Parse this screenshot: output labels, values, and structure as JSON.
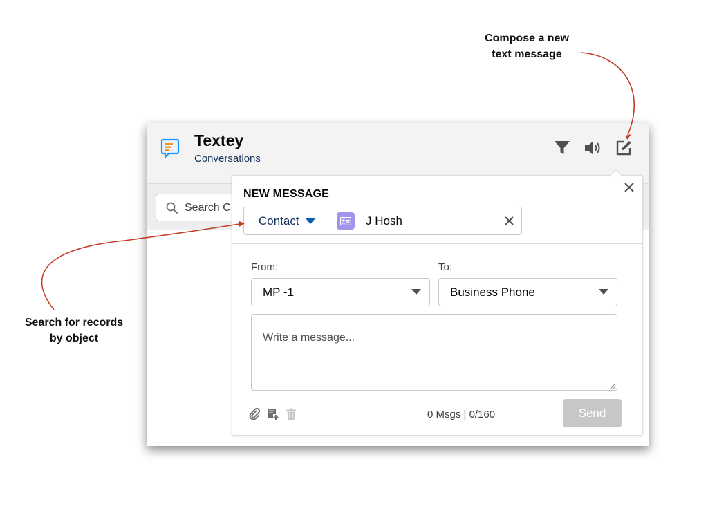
{
  "callouts": {
    "compose_line1": "Compose a new",
    "compose_line2": "text message",
    "search_line1": "Search for records",
    "search_line2": "by object"
  },
  "app": {
    "title": "Textey",
    "subtitle": "Conversations",
    "icon": "chat-bubble-icon",
    "header_actions": [
      {
        "icon": "filter-icon"
      },
      {
        "icon": "speaker-icon"
      },
      {
        "icon": "compose-icon"
      }
    ]
  },
  "search": {
    "placeholder": "Search C",
    "icon": "search-icon"
  },
  "new_message": {
    "title": "NEW MESSAGE",
    "close_icon": "close-icon",
    "lookup": {
      "object_label": "Contact",
      "record_name": "J Hosh",
      "record_icon": "contact-card-icon",
      "clear_icon": "close-icon"
    },
    "from": {
      "label": "From:",
      "value": "MP -1"
    },
    "to": {
      "label": "To:",
      "value": "Business Phone"
    },
    "message": {
      "placeholder": "Write a message..."
    },
    "toolbar": {
      "attach_icon": "paperclip-icon",
      "template_icon": "add-template-icon",
      "delete_icon": "trash-icon"
    },
    "counter": "0 Msgs | 0/160",
    "send_label": "Send"
  },
  "colors": {
    "accent": "#0b5cab",
    "arrow": "#c23b22",
    "contact_icon": "#a094ed",
    "send_disabled": "#c9c7c5"
  }
}
